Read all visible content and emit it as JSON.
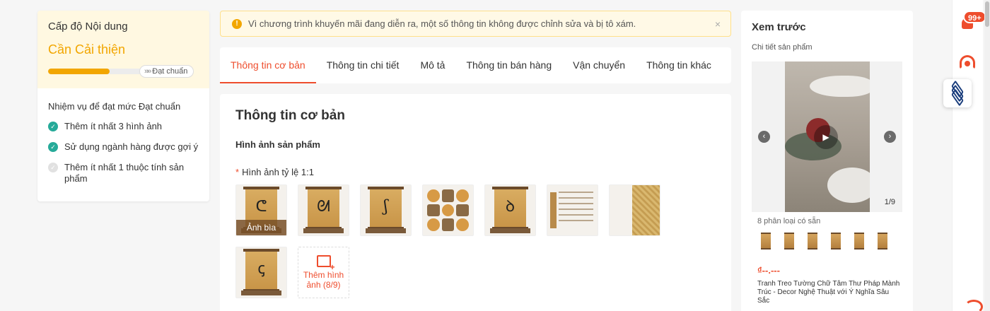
{
  "content_level": {
    "title": "Cấp độ Nội dung",
    "status": "Cần Cải thiện",
    "progress": 0.58,
    "standard_label": "Đạt chuẩn",
    "tasks_heading": "Nhiệm vụ để đạt mức Đạt chuẩn",
    "tasks": [
      {
        "label": "Thêm ít nhất 3 hình ảnh",
        "done": true
      },
      {
        "label": "Sử dụng ngành hàng được gợi ý",
        "done": true
      },
      {
        "label": "Thêm ít nhất 1 thuộc tính sản phẩm",
        "done": false
      }
    ]
  },
  "notice": {
    "text": "Vì chương trình khuyến mãi đang diễn ra, một số thông tin không được chỉnh sửa và bị tô xám.",
    "close": "×"
  },
  "tabs": [
    {
      "label": "Thông tin cơ bản",
      "active": true
    },
    {
      "label": "Thông tin chi tiết",
      "active": false
    },
    {
      "label": "Mô tả",
      "active": false
    },
    {
      "label": "Thông tin bán hàng",
      "active": false
    },
    {
      "label": "Vận chuyển",
      "active": false
    },
    {
      "label": "Thông tin khác",
      "active": false
    }
  ],
  "basic_info": {
    "title": "Thông tin cơ bản",
    "images_label": "Hình ảnh sản phẩm",
    "required_mark": "*",
    "ratio_label": "Hình ảnh tỷ lệ 1:1",
    "cover_label": "Ảnh bìa",
    "add_image": "Thêm hình ảnh (8/9)"
  },
  "preview": {
    "title": "Xem trước",
    "subtitle": "Chi tiết sản phẩm",
    "counter": "1/9",
    "variants": "8 phân loại có sẵn",
    "price": "₫--.---",
    "product_name": "Tranh Treo Tường Chữ Tâm Thư Pháp Mành Trúc - Decor Nghệ Thuật với Ý Nghĩa Sâu Sắc"
  },
  "sidebar": {
    "notification_count": "99+"
  },
  "colors": {
    "accent": "#ee4d2d",
    "warning": "#f2a600",
    "success": "#26aa99"
  },
  "icons": [
    "check-icon",
    "warning-icon",
    "close-icon",
    "play-icon",
    "chevron-left-icon",
    "chevron-right-icon",
    "bell-icon",
    "support-icon",
    "layers-icon",
    "add-image-icon"
  ]
}
